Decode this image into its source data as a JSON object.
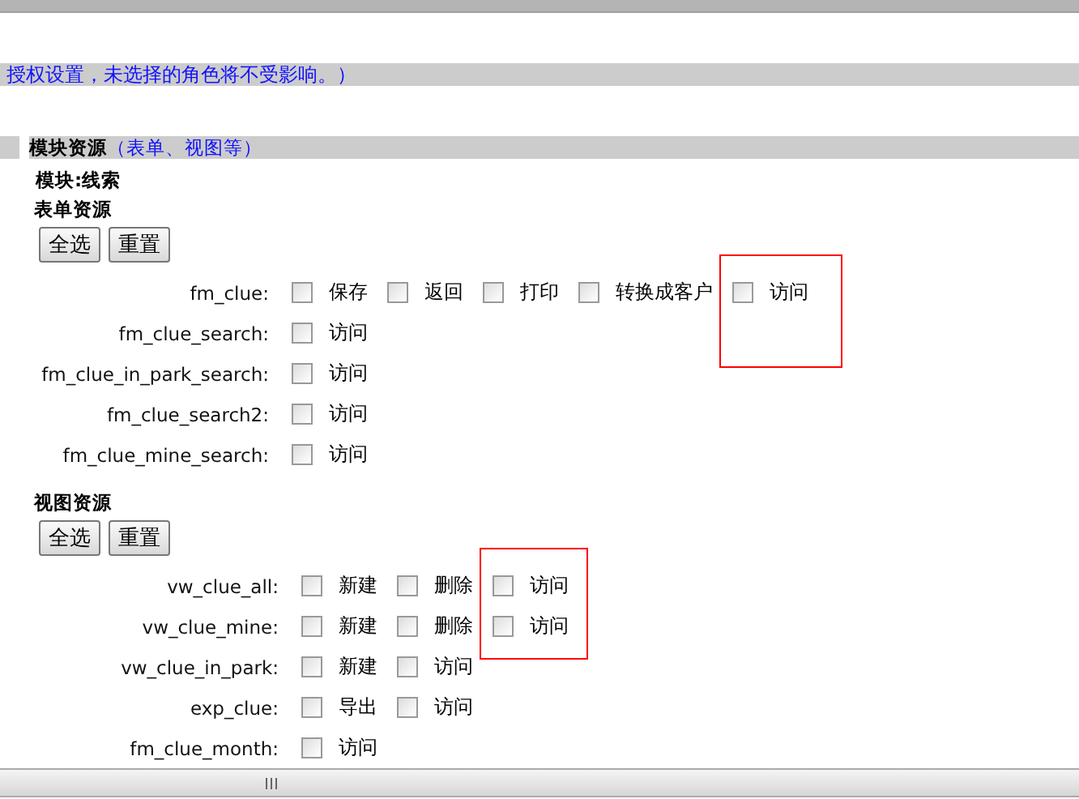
{
  "notice": "授权设置，未选择的角色将不受影响。）",
  "section": {
    "title": "模块资源",
    "subtitle": "（表单、视图等）"
  },
  "module": "模块:线索",
  "groups": [
    {
      "title": "表单资源",
      "buttons": [
        "全选",
        "重置"
      ],
      "rows": [
        {
          "name": "fm_clue:",
          "options": [
            {
              "label": "保存",
              "checked": false,
              "highlighted": false
            },
            {
              "label": "返回",
              "checked": false,
              "highlighted": false
            },
            {
              "label": "打印",
              "checked": false,
              "highlighted": false
            },
            {
              "label": "转换成客户",
              "checked": false,
              "highlighted": false
            },
            {
              "label": "访问",
              "checked": false,
              "highlighted": true
            }
          ]
        },
        {
          "name": "fm_clue_search:",
          "options": [
            {
              "label": "访问",
              "checked": false,
              "highlighted": false
            }
          ]
        },
        {
          "name": "fm_clue_in_park_search:",
          "options": [
            {
              "label": "访问",
              "checked": false,
              "highlighted": false
            }
          ]
        },
        {
          "name": "fm_clue_search2:",
          "options": [
            {
              "label": "访问",
              "checked": false,
              "highlighted": false
            }
          ]
        },
        {
          "name": "fm_clue_mine_search:",
          "options": [
            {
              "label": "访问",
              "checked": false,
              "highlighted": false
            }
          ]
        }
      ]
    },
    {
      "title": "视图资源",
      "buttons": [
        "全选",
        "重置"
      ],
      "rows": [
        {
          "name": "vw_clue_all:",
          "options": [
            {
              "label": "新建",
              "checked": false,
              "highlighted": false
            },
            {
              "label": "删除",
              "checked": false,
              "highlighted": false
            },
            {
              "label": "访问",
              "checked": false,
              "highlighted": true
            }
          ]
        },
        {
          "name": "vw_clue_mine:",
          "options": [
            {
              "label": "新建",
              "checked": false,
              "highlighted": false
            },
            {
              "label": "删除",
              "checked": false,
              "highlighted": false
            },
            {
              "label": "访问",
              "checked": false,
              "highlighted": true
            }
          ]
        },
        {
          "name": "vw_clue_in_park:",
          "options": [
            {
              "label": "新建",
              "checked": false,
              "highlighted": false
            },
            {
              "label": "访问",
              "checked": false,
              "highlighted": false
            }
          ]
        },
        {
          "name": "exp_clue:",
          "options": [
            {
              "label": "导出",
              "checked": false,
              "highlighted": false
            },
            {
              "label": "访问",
              "checked": false,
              "highlighted": false
            }
          ]
        },
        {
          "name": "fm_clue_month:",
          "options": [
            {
              "label": "访问",
              "checked": false,
              "highlighted": false
            }
          ]
        }
      ]
    }
  ]
}
